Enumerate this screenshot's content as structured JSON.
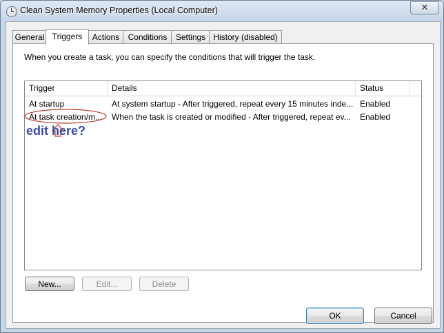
{
  "window": {
    "title": "Clean System Memory Properties (Local Computer)",
    "close_glyph": "✕"
  },
  "tabs": [
    {
      "label": "General",
      "active": false
    },
    {
      "label": "Triggers",
      "active": true
    },
    {
      "label": "Actions",
      "active": false
    },
    {
      "label": "Conditions",
      "active": false
    },
    {
      "label": "Settings",
      "active": false
    },
    {
      "label": "History (disabled)",
      "active": false
    }
  ],
  "triggers": {
    "description": "When you create a task, you can specify the conditions that will trigger the task.",
    "columns": {
      "trigger": "Trigger",
      "details": "Details",
      "status": "Status"
    },
    "rows": [
      {
        "trigger": "At startup",
        "details": "At system startup - After triggered, repeat every 15 minutes inde...",
        "status": "Enabled"
      },
      {
        "trigger": "At task creation/m...",
        "details": "When the task is created or modified - After triggered, repeat ev...",
        "status": "Enabled"
      }
    ],
    "buttons": {
      "new": "New...",
      "edit": "Edit...",
      "delete": "Delete"
    }
  },
  "annotation": {
    "text": "edit here?",
    "color": "#3b4ba3",
    "mark_color": "#c0392b"
  },
  "footer": {
    "ok": "OK",
    "cancel": "Cancel"
  }
}
